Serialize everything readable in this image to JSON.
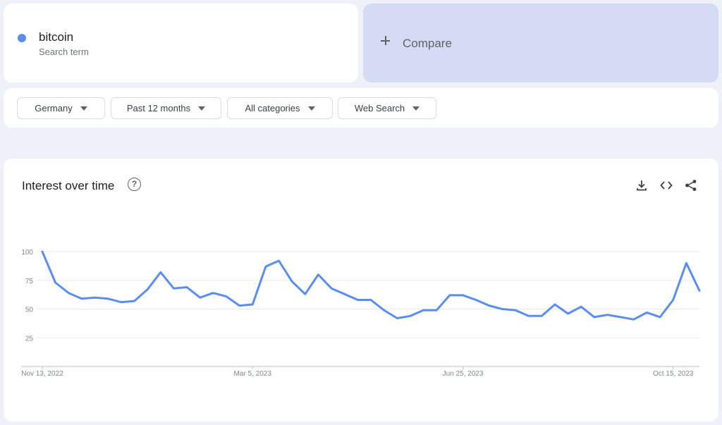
{
  "search_term": {
    "name": "bitcoin",
    "subtitle": "Search term",
    "color": "#5b8def"
  },
  "compare": {
    "label": "Compare",
    "icon": "plus-icon"
  },
  "filters": [
    {
      "label": "Germany"
    },
    {
      "label": "Past 12 months"
    },
    {
      "label": "All categories"
    },
    {
      "label": "Web Search"
    }
  ],
  "chart_card": {
    "title": "Interest over time",
    "help_icon": "help-circle-icon",
    "toolbar": [
      "download-icon",
      "embed-code-icon",
      "share-icon"
    ]
  },
  "chart_data": {
    "type": "line",
    "title": "",
    "xlabel": "",
    "ylabel": "",
    "ylim": [
      0,
      100
    ],
    "yticks": [
      25,
      50,
      75,
      100
    ],
    "grid": true,
    "x_tick_labels": [
      "Nov 13, 2022",
      "Mar 5, 2023",
      "Jun 25, 2023",
      "Oct 15, 2023"
    ],
    "x_tick_positions": [
      0,
      16,
      32,
      48
    ],
    "series": [
      {
        "color": "#5b8def",
        "values": [
          100,
          73,
          64,
          59,
          60,
          59,
          56,
          57,
          67,
          82,
          68,
          69,
          60,
          64,
          61,
          53,
          54,
          87,
          92,
          74,
          63,
          80,
          68,
          63,
          58,
          58,
          49,
          42,
          44,
          49,
          49,
          62,
          62,
          58,
          53,
          50,
          49,
          44,
          44,
          54,
          46,
          52,
          43,
          45,
          43,
          41,
          47,
          43,
          58,
          90,
          66
        ]
      }
    ]
  }
}
